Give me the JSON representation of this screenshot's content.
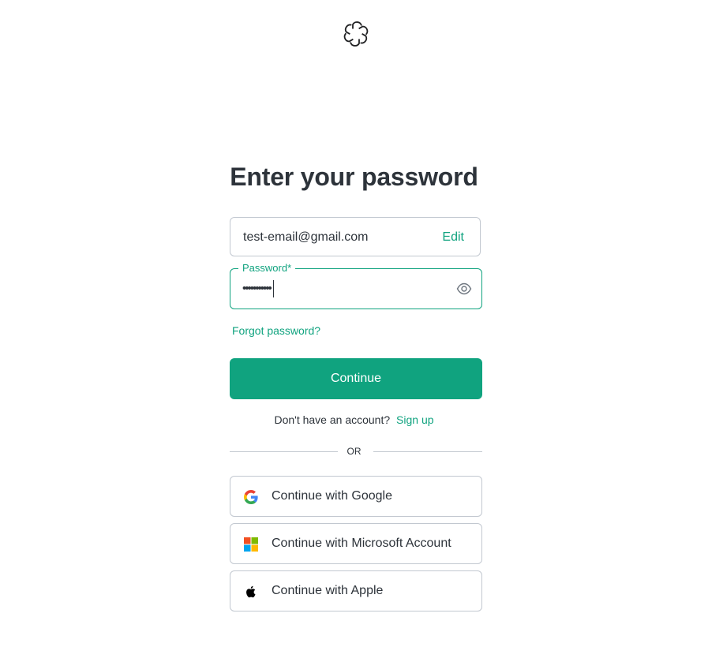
{
  "brand": {
    "logo_icon": "openai-logo-icon",
    "accent": "#10a37f"
  },
  "page": {
    "title": "Enter your password"
  },
  "email": {
    "value": "test-email@gmail.com",
    "edit_label": "Edit"
  },
  "password": {
    "label": "Password*",
    "masked_value": "•••••••••••",
    "toggle_icon": "eye-icon"
  },
  "forgot_label": "Forgot password?",
  "continue_label": "Continue",
  "signup": {
    "prompt": "Don't have an account?",
    "link_label": "Sign up"
  },
  "divider_label": "OR",
  "social": [
    {
      "label": "Continue with Google",
      "icon": "google-icon"
    },
    {
      "label": "Continue with Microsoft Account",
      "icon": "microsoft-icon"
    },
    {
      "label": "Continue with Apple",
      "icon": "apple-icon"
    }
  ]
}
